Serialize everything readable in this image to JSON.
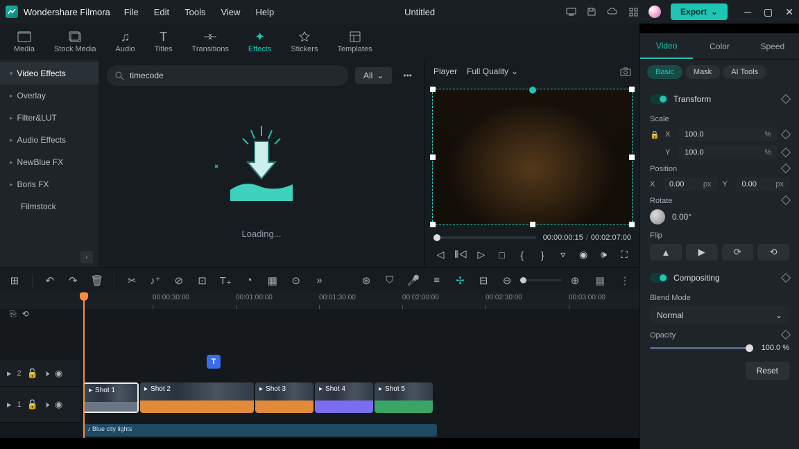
{
  "app": {
    "title": "Wondershare Filmora",
    "document": "Untitled",
    "export": "Export"
  },
  "menu": [
    "File",
    "Edit",
    "Tools",
    "View",
    "Help"
  ],
  "categoryTabs": [
    {
      "label": "Media"
    },
    {
      "label": "Stock Media"
    },
    {
      "label": "Audio"
    },
    {
      "label": "Titles"
    },
    {
      "label": "Transitions"
    },
    {
      "label": "Effects",
      "active": true
    },
    {
      "label": "Stickers"
    },
    {
      "label": "Templates"
    }
  ],
  "sidebar": {
    "items": [
      {
        "label": "Video Effects",
        "active": true
      },
      {
        "label": "Overlay"
      },
      {
        "label": "Filter&LUT"
      },
      {
        "label": "Audio Effects"
      },
      {
        "label": "NewBlue FX"
      },
      {
        "label": "Boris FX"
      },
      {
        "label": "Filmstock"
      }
    ]
  },
  "search": {
    "value": "timecode",
    "allLabel": "All"
  },
  "browser": {
    "loading": "Loading..."
  },
  "preview": {
    "playerLabel": "Player",
    "quality": "Full Quality",
    "current": "00:00:00:15",
    "total": "00:02:07:00"
  },
  "props": {
    "tabs": [
      "Video",
      "Color",
      "Speed"
    ],
    "subtabs": [
      "Basic",
      "Mask",
      "AI Tools"
    ],
    "transform": "Transform",
    "scale": {
      "label": "Scale",
      "x": "100.0",
      "y": "100.0",
      "unit": "%"
    },
    "position": {
      "label": "Position",
      "x": "0.00",
      "y": "0.00",
      "unit": "px"
    },
    "rotate": {
      "label": "Rotate",
      "value": "0.00°"
    },
    "flip": "Flip",
    "compositing": "Compositing",
    "blend": {
      "label": "Blend Mode",
      "value": "Normal"
    },
    "opacity": {
      "label": "Opacity",
      "value": "100.0",
      "unit": "%"
    },
    "reset": "Reset"
  },
  "timeline": {
    "ticks": [
      "00:00:30:00",
      "00:01:00:00",
      "00:01:30:00",
      "00:02:00:00",
      "00:02:30:00",
      "00:03:00:00"
    ],
    "clips": [
      "Shot 1",
      "Shot 2",
      "Shot 3",
      "Shot 4",
      "Shot 5"
    ],
    "audio": "Blue city lights"
  }
}
